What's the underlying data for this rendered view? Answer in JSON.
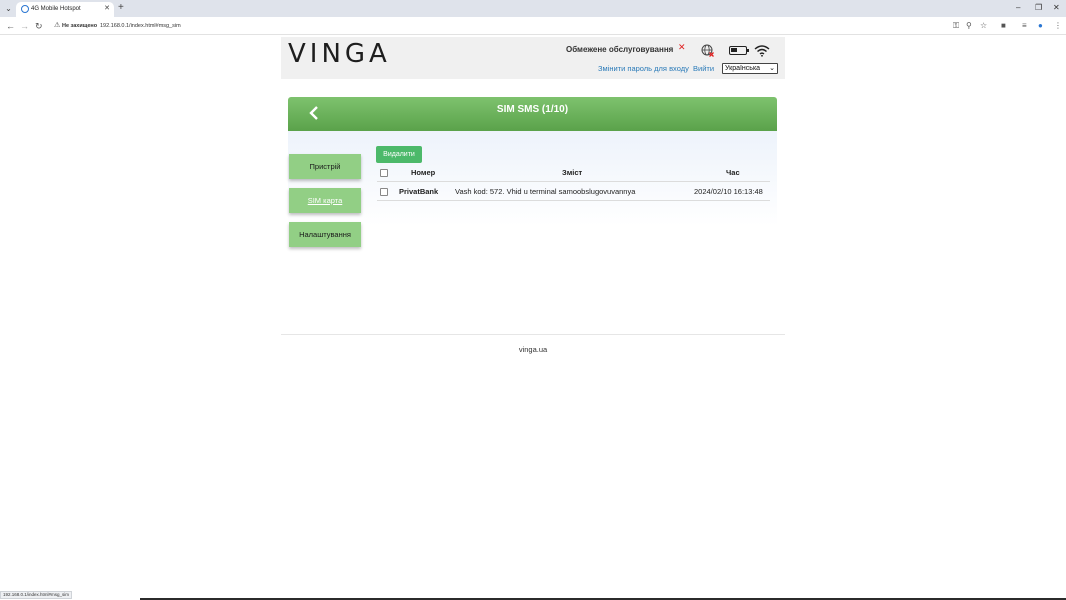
{
  "browser": {
    "tab_title": "4G Mobile Hotspot",
    "insecure_label": "Не захищено",
    "url": "192.168.0.1/index.html#msg_sim",
    "status_url": "192.168.0.1/index.html#msg_sim"
  },
  "header": {
    "logo": "VINGA",
    "service_status": "Обмежене обслуговування",
    "change_password": "Змінити пароль для входу",
    "logout": "Вийти",
    "language": "Українська"
  },
  "page": {
    "title": "SIM SMS (1/10)"
  },
  "sidebar": {
    "items": [
      {
        "label": "Пристрій"
      },
      {
        "label": "SIM карта"
      },
      {
        "label": "Налаштування"
      }
    ]
  },
  "messages": {
    "delete_label": "Видалити",
    "columns": [
      "Номер",
      "Зміст",
      "Час"
    ],
    "rows": [
      {
        "number": "PrivatBank",
        "content": "Vash kod: 572. Vhid u terminal samoobslugovuvannya",
        "time": "2024/02/10 16:13:48"
      }
    ]
  },
  "footer": {
    "text": "vinga.ua"
  }
}
